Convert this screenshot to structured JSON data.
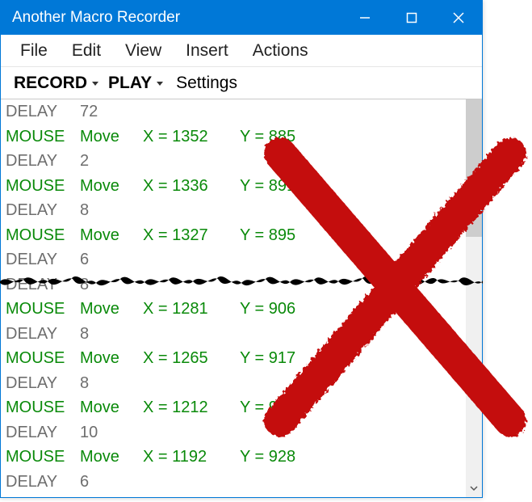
{
  "window": {
    "title": "Another Macro Recorder"
  },
  "menubar": {
    "items": [
      "File",
      "Edit",
      "View",
      "Insert",
      "Actions"
    ]
  },
  "toolbar": {
    "record": "RECORD",
    "play": "PLAY",
    "settings": "Settings"
  },
  "events": [
    {
      "type": "DELAY",
      "val": "72"
    },
    {
      "type": "MOUSE",
      "action": "Move",
      "x": "X = 1352",
      "y": "Y = 885"
    },
    {
      "type": "DELAY",
      "val": "2"
    },
    {
      "type": "MOUSE",
      "action": "Move",
      "x": "X = 1336",
      "y": "Y = 891"
    },
    {
      "type": "DELAY",
      "val": "8"
    },
    {
      "type": "MOUSE",
      "action": "Move",
      "x": "X = 1327",
      "y": "Y = 895"
    },
    {
      "type": "DELAY",
      "val": "6"
    },
    {
      "type": "DELAY",
      "val": "8"
    },
    {
      "type": "MOUSE",
      "action": "Move",
      "x": "X = 1281",
      "y": "Y = 906"
    },
    {
      "type": "DELAY",
      "val": "8"
    },
    {
      "type": "MOUSE",
      "action": "Move",
      "x": "X = 1265",
      "y": "Y = 917"
    },
    {
      "type": "DELAY",
      "val": "8"
    },
    {
      "type": "MOUSE",
      "action": "Move",
      "x": "X = 1212",
      "y": "Y = 923"
    },
    {
      "type": "DELAY",
      "val": "10"
    },
    {
      "type": "MOUSE",
      "action": "Move",
      "x": "X = 1192",
      "y": "Y = 928"
    },
    {
      "type": "DELAY",
      "val": "6"
    }
  ]
}
